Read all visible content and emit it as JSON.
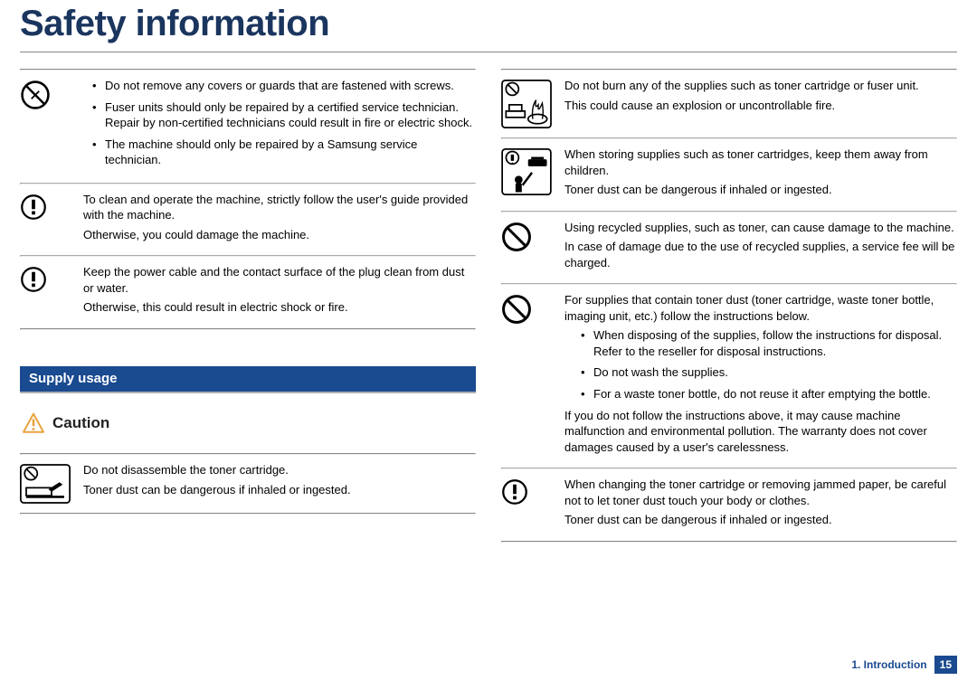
{
  "title": "Safety information",
  "left": {
    "rows": [
      {
        "icon": "no-tools",
        "bullets": [
          "Do not remove any covers or guards that are fastened with screws.",
          "Fuser units should only be repaired by a certified service technician. Repair by non-certified technicians could result in fire or electric shock.",
          "The machine should only be repaired by a Samsung service technician."
        ]
      },
      {
        "icon": "exclaim-circle",
        "paras": [
          "To clean and operate the machine, strictly follow the user's guide provided with the machine.",
          "Otherwise, you could damage the machine."
        ]
      },
      {
        "icon": "exclaim-circle",
        "paras": [
          "Keep the power cable and the contact surface of the plug clean from dust or water.",
          "Otherwise, this could result in electric shock or fire."
        ]
      }
    ],
    "section_band": "Supply usage",
    "caution_label": "Caution",
    "caution_rows": [
      {
        "icon": "no-disassemble",
        "paras": [
          "Do not disassemble the toner cartridge.",
          "Toner dust can be dangerous if inhaled or ingested."
        ]
      }
    ]
  },
  "right": {
    "rows": [
      {
        "icon": "no-burn",
        "paras": [
          "Do not burn any of the supplies such as toner cartridge or fuser unit.",
          "This could cause an explosion or uncontrollable fire."
        ]
      },
      {
        "icon": "keep-away-children",
        "paras": [
          "When storing supplies such as toner cartridges, keep them away from children.",
          "Toner dust can be dangerous if inhaled or ingested."
        ]
      },
      {
        "icon": "prohibit",
        "paras": [
          "Using recycled supplies, such as toner, can cause damage to the machine.",
          "In case of damage due to the use of recycled supplies, a service fee will be charged."
        ]
      },
      {
        "icon": "prohibit",
        "intro": "For supplies that contain toner dust (toner cartridge, waste toner bottle, imaging unit, etc.) follow the instructions below.",
        "bullets": [
          "When disposing of the supplies, follow the instructions for disposal. Refer to the reseller for disposal instructions.",
          "Do not wash the supplies.",
          "For a waste toner bottle, do not reuse it after emptying the bottle."
        ],
        "outro": "If you do not follow the instructions above, it may cause machine malfunction and environmental pollution. The warranty does not cover damages caused by a user's carelessness."
      },
      {
        "icon": "exclaim-circle",
        "paras": [
          "When changing the toner cartridge or removing jammed paper, be careful not to let toner dust touch your body or clothes.",
          "Toner dust can be dangerous if inhaled or ingested."
        ]
      }
    ]
  },
  "footer": {
    "chapter": "1. Introduction",
    "page": "15"
  }
}
